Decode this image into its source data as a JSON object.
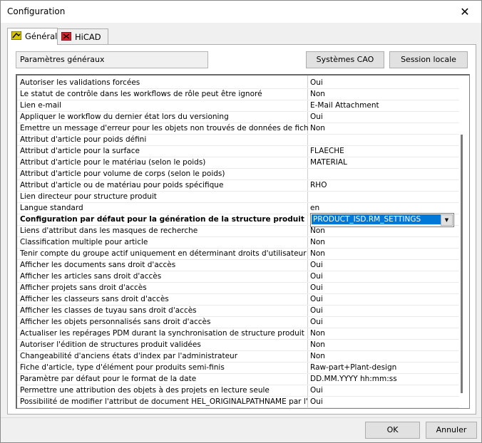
{
  "window": {
    "title": "Configuration",
    "close_glyph": "✕"
  },
  "tabs": [
    {
      "label": "Général",
      "icon": "general-tab-icon",
      "active": true
    },
    {
      "label": "HiCAD",
      "icon": "hicad-tab-icon",
      "active": false
    }
  ],
  "group_label": "Paramètres généraux",
  "buttons": {
    "systems_cao": "Systèmes CAO",
    "local_session": "Session locale",
    "ok": "OK",
    "cancel": "Annuler"
  },
  "settings": [
    {
      "key": "Autoriser les validations forcées",
      "value": "Oui"
    },
    {
      "key": "Le statut de contrôle dans les workflows de rôle peut être ignoré",
      "value": "Non"
    },
    {
      "key": "Lien e-mail",
      "value": "E-Mail Attachment"
    },
    {
      "key": "Appliquer le workflow du dernier état lors du versioning",
      "value": "Oui"
    },
    {
      "key": "Émettre un message d'erreur pour les objets non trouvés de données de fiche",
      "value": "Non"
    },
    {
      "key": "Attribut d'article pour poids défini",
      "value": ""
    },
    {
      "key": "Attribut d'article pour la surface",
      "value": "FLAECHE"
    },
    {
      "key": "Attribut d'article pour le matériau (selon le poids)",
      "value": "MATERIAL"
    },
    {
      "key": "Attribut d'article pour volume de corps (selon le poids)",
      "value": ""
    },
    {
      "key": "Attribut d'article ou de matériau pour poids spécifique",
      "value": "RHO"
    },
    {
      "key": "Lien directeur pour structure produit",
      "value": ""
    },
    {
      "key": "Langue standard",
      "value": "en"
    },
    {
      "key": "Configuration par défaut pour la génération de la structure produit",
      "value": "PRODUCT_ISD.RM_SETTINGS",
      "selected": true
    },
    {
      "key": "Liens d'attribut dans les masques de recherche",
      "value": "Non"
    },
    {
      "key": "Classification multiple pour article",
      "value": "Non"
    },
    {
      "key": "Tenir compte du groupe actif uniquement en déterminant droits d'utilisateur",
      "value": "Non"
    },
    {
      "key": "Afficher les documents sans droit d'accès",
      "value": "Oui"
    },
    {
      "key": "Afficher les articles sans droit d'accès",
      "value": "Oui"
    },
    {
      "key": "Afficher projets sans droit d'accès",
      "value": "Oui"
    },
    {
      "key": "Afficher les classeurs sans droit d'accès",
      "value": "Oui"
    },
    {
      "key": "Afficher les classes de tuyau sans droit d'accès",
      "value": "Oui"
    },
    {
      "key": "Afficher les objets personnalisés sans droit d'accès",
      "value": "Oui"
    },
    {
      "key": "Actualiser les repérages PDM durant la synchronisation de structure produit",
      "value": "Non"
    },
    {
      "key": "Autoriser l'édition de structures produit validées",
      "value": "Non"
    },
    {
      "key": "Changeabilité d'anciens états d'index par l'administrateur",
      "value": "Non"
    },
    {
      "key": "Fiche d'article, type d'élément pour produits semi-finis",
      "value": "Raw-part+Plant-design"
    },
    {
      "key": "Paramètre par défaut pour le format de la date",
      "value": "DD.MM.YYYY hh:mm:ss"
    },
    {
      "key": "Permettre une attribution des objets à des projets en lecture seule",
      "value": "Oui"
    },
    {
      "key": "Possibilité de modifier l'attribut de document   HEL_ORIGINALPATHNAME par l'administrateur",
      "value": "Oui"
    }
  ]
}
